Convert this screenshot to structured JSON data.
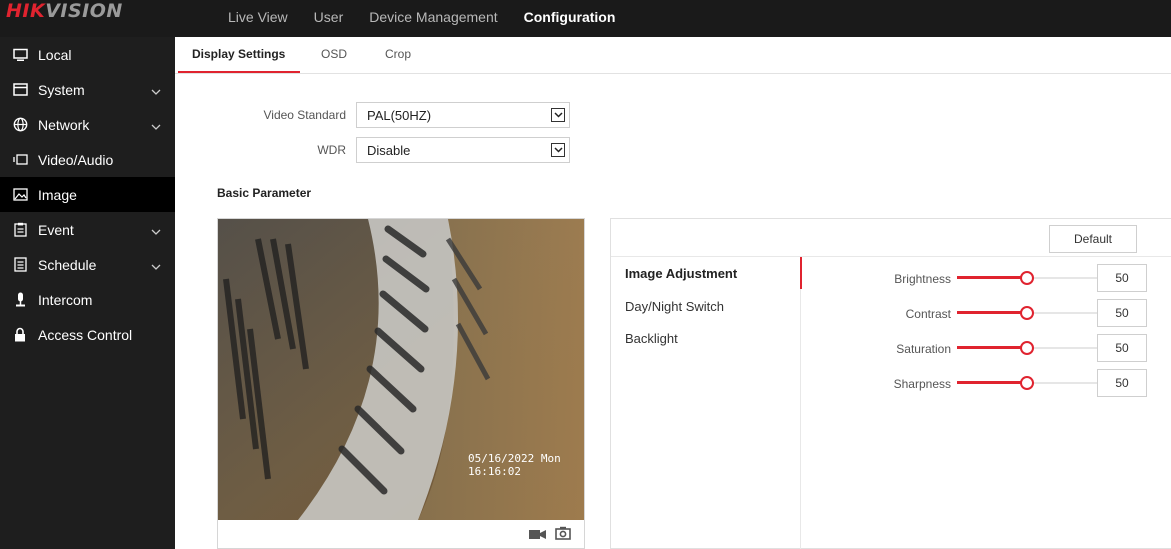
{
  "header": {
    "logo_hik": "HIK",
    "logo_vision": "VISION",
    "nav": [
      {
        "label": "Live View",
        "active": false
      },
      {
        "label": "User",
        "active": false
      },
      {
        "label": "Device Management",
        "active": false
      },
      {
        "label": "Configuration",
        "active": true
      }
    ]
  },
  "sidebar": {
    "items": [
      {
        "label": "Local",
        "icon": "monitor-icon",
        "expandable": false,
        "active": false
      },
      {
        "label": "System",
        "icon": "system-window-icon",
        "expandable": true,
        "active": false
      },
      {
        "label": "Network",
        "icon": "globe-icon",
        "expandable": true,
        "active": false
      },
      {
        "label": "Video/Audio",
        "icon": "video-audio-icon",
        "expandable": false,
        "active": false
      },
      {
        "label": "Image",
        "icon": "image-icon",
        "expandable": false,
        "active": true
      },
      {
        "label": "Event",
        "icon": "clipboard-icon",
        "expandable": true,
        "active": false
      },
      {
        "label": "Schedule",
        "icon": "schedule-list-icon",
        "expandable": true,
        "active": false
      },
      {
        "label": "Intercom",
        "icon": "microphone-icon",
        "expandable": false,
        "active": false
      },
      {
        "label": "Access Control",
        "icon": "lock-icon",
        "expandable": false,
        "active": false
      }
    ]
  },
  "tabs": [
    {
      "label": "Display Settings",
      "active": true
    },
    {
      "label": "OSD",
      "active": false
    },
    {
      "label": "Crop",
      "active": false
    }
  ],
  "form": {
    "video_standard_label": "Video Standard",
    "video_standard_value": "PAL(50HZ)",
    "wdr_label": "WDR",
    "wdr_value": "Disable"
  },
  "basic_parameter_title": "Basic Parameter",
  "video": {
    "osd_time": "05/16/2022 Mon 16:16:02",
    "toolbar_icons": [
      "record-icon",
      "snapshot-icon"
    ]
  },
  "panel": {
    "default_label": "Default",
    "menu": [
      {
        "label": "Image Adjustment",
        "active": true
      },
      {
        "label": "Day/Night Switch",
        "active": false
      },
      {
        "label": "Backlight",
        "active": false
      }
    ],
    "sliders": [
      {
        "label": "Brightness",
        "value": 50
      },
      {
        "label": "Contrast",
        "value": 50
      },
      {
        "label": "Saturation",
        "value": 50
      },
      {
        "label": "Sharpness",
        "value": 50
      }
    ],
    "slider_max": 100
  },
  "colors": {
    "accent": "#e0232f",
    "topbar": "#1a1a1a",
    "sidebar": "#1e1e1e",
    "sidebar_active": "#000000"
  }
}
